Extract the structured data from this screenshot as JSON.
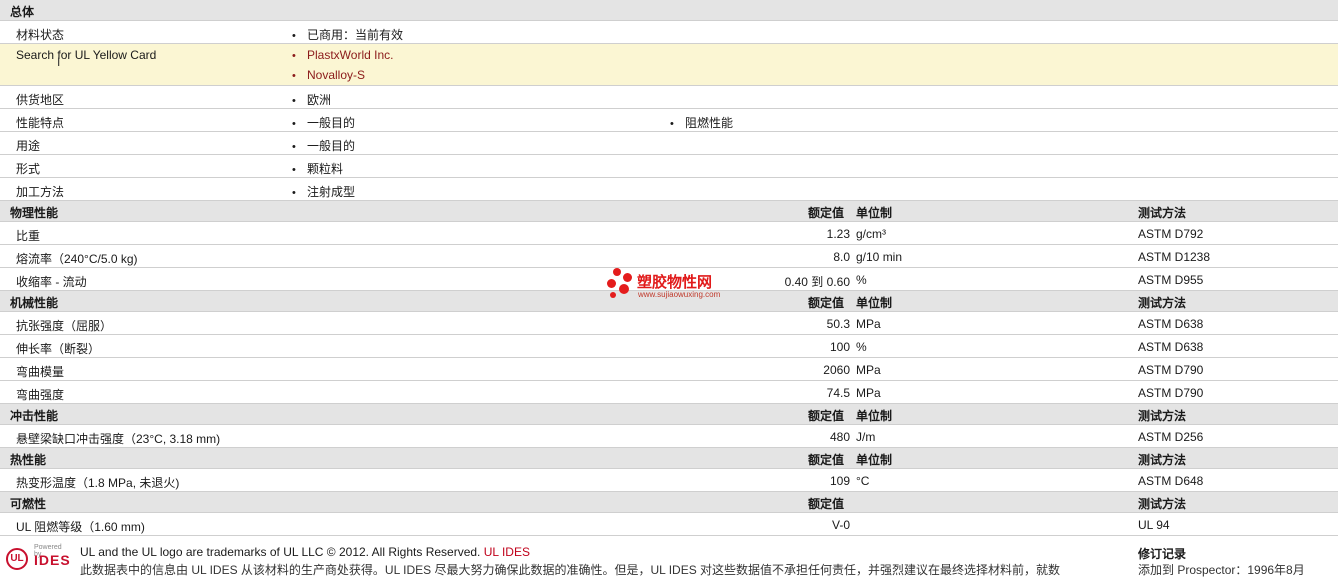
{
  "general": {
    "title": "总体",
    "rows": [
      {
        "label": "材料状态",
        "items": [
          "已商用：当前有效"
        ]
      },
      {
        "label": "Search for UL Yellow Card",
        "items": [
          "PlastxWorld Inc.",
          "Novalloy-S"
        ]
      },
      {
        "label": "供货地区",
        "items": [
          "欧洲"
        ]
      },
      {
        "label": "性能特点",
        "items": [
          "一般目的",
          "阻燃性能"
        ]
      },
      {
        "label": "用途",
        "items": [
          "一般目的"
        ]
      },
      {
        "label": "形式",
        "items": [
          "颗粒料"
        ]
      },
      {
        "label": "加工方法",
        "items": [
          "注射成型"
        ]
      }
    ]
  },
  "headers": {
    "value": "额定值",
    "unit": "单位制",
    "test": "测试方法"
  },
  "physical": {
    "title": "物理性能",
    "rows": [
      {
        "label": "比重",
        "value": "1.23",
        "unit": "g/cm³",
        "test": "ASTM D792"
      },
      {
        "label": "熔流率（240°C/5.0 kg)",
        "value": "8.0",
        "unit": "g/10 min",
        "test": "ASTM D1238"
      },
      {
        "label": "收缩率  - 流动",
        "value": "0.40 到  0.60",
        "unit": "%",
        "test": "ASTM D955"
      }
    ]
  },
  "mechanical": {
    "title": "机械性能",
    "rows": [
      {
        "label": "抗张强度（屈服）",
        "value": "50.3",
        "unit": "MPa",
        "test": "ASTM D638"
      },
      {
        "label": "伸长率（断裂）",
        "value": "100",
        "unit": "%",
        "test": "ASTM D638"
      },
      {
        "label": "弯曲模量",
        "value": "2060",
        "unit": "MPa",
        "test": "ASTM D790"
      },
      {
        "label": "弯曲强度",
        "value": "74.5",
        "unit": "MPa",
        "test": "ASTM D790"
      }
    ]
  },
  "impact": {
    "title": "冲击性能",
    "rows": [
      {
        "label": "悬壁梁缺口冲击强度（23°C, 3.18 mm)",
        "value": "480",
        "unit": "J/m",
        "test": "ASTM D256"
      }
    ]
  },
  "thermal": {
    "title": "热性能",
    "rows": [
      {
        "label": "热变形温度（1.8 MPa, 未退火)",
        "value": "109",
        "unit": "°C",
        "test": "ASTM D648"
      }
    ]
  },
  "flammability": {
    "title": "可燃性",
    "rows": [
      {
        "label": "UL 阻燃等级（1.60 mm)",
        "value": "V-0",
        "unit": "",
        "test": "UL 94"
      }
    ]
  },
  "watermark": {
    "title": "塑胶物性网",
    "url": "www.sujiaowuxing.com"
  },
  "footer": {
    "logo_text": "UL",
    "logo_powered": "Powered by",
    "logo_brand": "IDES",
    "trademark": "UL and the UL logo are trademarks of UL LLC © 2012. All Rights Reserved.",
    "trademark_link": "UL IDES",
    "disclaimer": "此数据表中的信息由 UL IDES 从该材料的生产商处获得。UL IDES 尽最大努力确保此数据的准确性。但是，UL IDES 对这些数据值不承担任何责任，并强烈建议在最终选择材料前，就数",
    "revision_title": "修订记录",
    "revision_text": "添加到 Prospector：1996年8月"
  },
  "colors": {
    "section_bg": "#e4e4e4",
    "highlight_bg": "#fbf6d3",
    "link": "#8b1a1a",
    "accent": "#c8102e"
  }
}
